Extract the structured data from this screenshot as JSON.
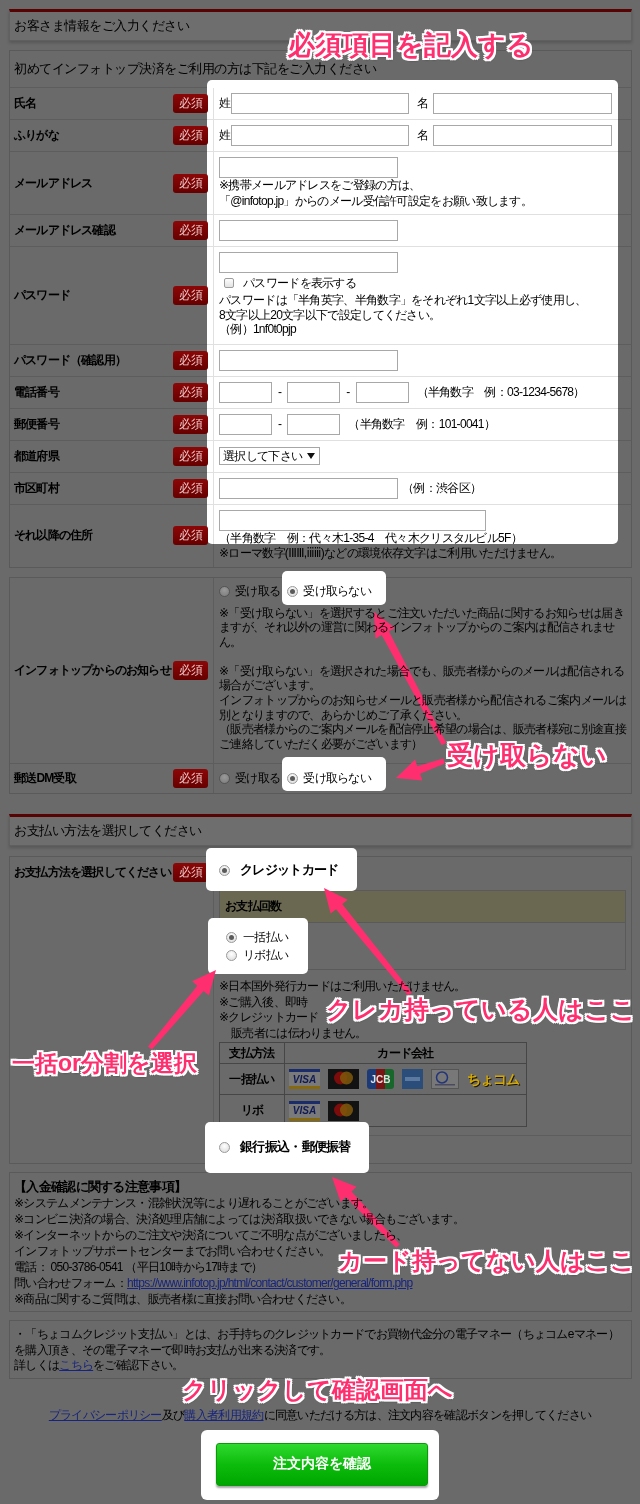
{
  "customer_info": {
    "title": "お客さま情報をご入力ください",
    "callout": "必須項目を記入する",
    "form": {
      "caption": "初めてインフォトップ決済をご利用の方は下記をご入力ください",
      "highlight": true,
      "rows": [
        {
          "kind": "name",
          "label": "氏名",
          "badge": "必須",
          "fields": [
            {
              "prefix": "姓"
            },
            {
              "prefix": "名"
            }
          ]
        },
        {
          "kind": "name",
          "label": "ふりがな",
          "badge": "必須",
          "fields": [
            {
              "prefix": "姓"
            },
            {
              "prefix": "名"
            }
          ]
        },
        {
          "kind": "text",
          "label": "メールアドレス",
          "badge": "必須",
          "notes": [
            "※携帯メールアドレスをご登録の方は、",
            "「@infotop.jp」からのメール受信許可設定をお願い致します。"
          ]
        },
        {
          "kind": "text",
          "label": "メールアドレス確認",
          "badge": "必須"
        },
        {
          "kind": "password",
          "label": "パスワード",
          "badge": "必須",
          "checkbox": {
            "label": "パスワードを表示する",
            "checked": false
          },
          "notes": [
            "パスワードは「半角英字、半角数字」をそれぞれ1文字以上必ず使用し、",
            "8文字以上20文字以下で設定してください。",
            "（例）1nf0t0pjp"
          ]
        },
        {
          "kind": "text",
          "label": "パスワード（確認用）",
          "badge": "必須"
        },
        {
          "kind": "split",
          "label": "電話番号",
          "badge": "必須",
          "separators": [
            "-",
            "-"
          ],
          "hint": "（半角数字　例：03-1234-5678）"
        },
        {
          "kind": "split",
          "label": "郵便番号",
          "badge": "必須",
          "separators": [
            "-"
          ],
          "hint": "（半角数字　例：101-0041）"
        },
        {
          "kind": "select",
          "label": "都道府県",
          "badge": "必須",
          "value": "選択して下さい"
        },
        {
          "kind": "text",
          "label": "市区町村",
          "badge": "必須",
          "hint": "（例：渋谷区）"
        },
        {
          "kind": "wide",
          "label": "それ以降の住所",
          "badge": "必須",
          "notes": [
            "（半角数字　例：代々木1-35-4　代々木クリスタルビル5F）",
            "※ローマ数字(ⅠⅡⅢ,ⅰⅱⅲ)などの環境依存文字はご利用いただけません。"
          ]
        }
      ]
    }
  },
  "notifications": {
    "callout": "受け取らない",
    "rows": [
      {
        "label": "インフォトップからのお知らせ",
        "badge": "必須",
        "options": [
          {
            "label": "受け取る",
            "selected": false,
            "highlight": false
          },
          {
            "label": "受け取らない",
            "selected": true,
            "highlight": true
          }
        ],
        "paragraphs": [
          [
            "※「受け取らない」を選択するとご注文いただいた商品に関するお知らせは届きますが、それ以外の運営に関わるインフォトップからのご案内は配信されません。"
          ],
          [
            "※「受け取らない」を選択された場合でも、販売者様からのメールは配信される場合がございます。",
            "インフォトップからのお知らせメールと販売者様から配信されるご案内メールは別となりますので、あらかじめご了承ください。",
            "（販売者様からのご案内メールを配信停止希望の場合は、販売者様宛に別途直接ご連絡していただく必要がございます）"
          ]
        ]
      },
      {
        "label": "郵送DM受取",
        "badge": "必須",
        "options": [
          {
            "label": "受け取る",
            "selected": false,
            "highlight": false
          },
          {
            "label": "受け取らない",
            "selected": true,
            "highlight": true
          }
        ]
      }
    ]
  },
  "payment": {
    "title": "お支払い方法を選択してください",
    "label": "お支払方法を選択してください",
    "badge": "必須",
    "methods": [
      {
        "label": "クレジットカード",
        "selected": true,
        "highlight": true,
        "callout": "クレカ持っている人はここ",
        "installments": {
          "title": "お支払回数",
          "highlight": true,
          "callout": "一括or分割を選択",
          "options": [
            {
              "label": "一括払い",
              "selected": true
            },
            {
              "label": "リボ払い",
              "selected": false
            }
          ]
        },
        "notes": [
          [
            "※日本国外発行カードはご利用いただけません。"
          ],
          [
            "※ご購入後、即時"
          ],
          [
            "※クレジットカード",
            "販売者には伝わりません。"
          ]
        ],
        "card_table": {
          "columns": [
            "支払方法",
            "カード会社"
          ],
          "rows": [
            {
              "label": "一括払い",
              "cards": [
                {
                  "kind": "visa",
                  "text": "VISA"
                },
                {
                  "kind": "mastercard"
                },
                {
                  "kind": "jcb",
                  "text": "JCB"
                },
                {
                  "kind": "amex"
                },
                {
                  "kind": "diners"
                },
                {
                  "kind": "chocom",
                  "text": "ちょコム"
                }
              ]
            },
            {
              "label": "リボ",
              "cards": [
                {
                  "kind": "visa",
                  "text": "VISA"
                },
                {
                  "kind": "mastercard"
                }
              ]
            }
          ]
        }
      },
      {
        "label": "銀行振込・郵便振替",
        "selected": false,
        "highlight": true,
        "callout": "カード持ってない人はここ"
      }
    ]
  },
  "payment_notice": {
    "title": "【入金確認に関する注意事項】",
    "lines": [
      "※システムメンテナンス・混雑状況等により遅れることがございます。",
      "※コンビニ決済の場合、決済処理店舗によっては決済取扱いできない場合もございます。",
      "※インターネットからのご注文や決済についてご不明な点がございましたら、",
      "インフォトップサポートセンターまでお問い合わせください。",
      "電話： 050-3786-0541 （平日10時から17時まで）",
      {
        "parts": [
          {
            "text": "問い合わせフォーム："
          },
          {
            "link": "https://www.infotop.jp/html/contact/customer/general/form.php"
          }
        ]
      },
      "※商品に関するご質問は、販売者様に直接お問い合わせください。"
    ]
  },
  "chocom_info": {
    "paragraph": "・「ちょコムクレジット支払い」とは、お手持ちのクレジットカードでお買物代金分の電子マネー（ちょコムeマネー）を購入頂き、その電子マネーで即時お支払が出来る決済です。",
    "more": {
      "parts": [
        {
          "text": "詳しくは"
        },
        {
          "link": "こちら"
        },
        {
          "text": "をご確認下さい。"
        }
      ]
    }
  },
  "footer": {
    "callout": "クリックして確認画面へ",
    "consent": {
      "parts": [
        {
          "link": "プライバシーポリシー"
        },
        {
          "text": "及び"
        },
        {
          "link": "購入者利用規約"
        },
        {
          "text": "に同意いただける方は、注文内容を確認ボタンを押してください"
        }
      ]
    },
    "submit": {
      "label": "注文内容を確認",
      "highlight": true
    }
  }
}
